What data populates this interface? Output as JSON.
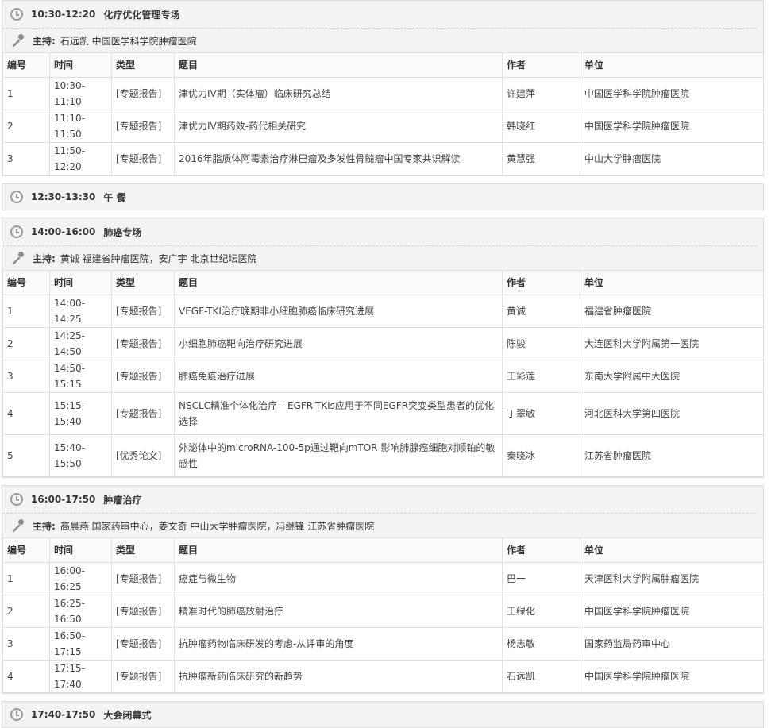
{
  "columns": [
    "编号",
    "时间",
    "类型",
    "题目",
    "作者",
    "单位"
  ],
  "sessions": [
    {
      "time": "10:30-12:20",
      "title": "化疗优化管理专场",
      "host_label": "主持:",
      "host": "石远凯 中国医学科学院肿瘤医院",
      "rows": [
        [
          "1",
          "10:30-11:10",
          "[专题报告]",
          "津优力IV期（实体瘤）临床研究总结",
          "许建萍",
          "中国医学科学院肿瘤医院"
        ],
        [
          "2",
          "11:10-11:50",
          "[专题报告]",
          "津优力IV期药效-药代相关研究",
          "韩晓红",
          "中国医学科学院肿瘤医院"
        ],
        [
          "3",
          "11:50-12:20",
          "[专题报告]",
          "2016年脂质体阿霉素治疗淋巴瘤及多发性骨髓瘤中国专家共识解读",
          "黄慧强",
          "中山大学肿瘤医院"
        ]
      ]
    },
    {
      "time": "12:30-13:30",
      "title": "午 餐"
    },
    {
      "time": "14:00-16:00",
      "title": "肺癌专场",
      "host_label": "主持:",
      "host": "黄诚 福建省肿瘤医院，安广宇 北京世纪坛医院",
      "rows": [
        [
          "1",
          "14:00-14:25",
          "[专题报告]",
          "VEGF-TKI治疗晚期非小细胞肺癌临床研究进展",
          "黄诚",
          "福建省肿瘤医院"
        ],
        [
          "2",
          "14:25-14:50",
          "[专题报告]",
          "小细胞肺癌靶向治疗研究进展",
          "陈骏",
          "大连医科大学附属第一医院"
        ],
        [
          "3",
          "14:50-15:15",
          "[专题报告]",
          "肺癌免疫治疗进展",
          "王彩莲",
          "东南大学附属中大医院"
        ],
        [
          "4",
          "15:15-15:40",
          "[专题报告]",
          "NSCLC精准个体化治疗---EGFR-TKIs应用于不同EGFR突变类型患者的优化选择",
          "丁翠敏",
          "河北医科大学第四医院"
        ],
        [
          "5",
          "15:40-15:50",
          "[优秀论文]",
          "外泌体中的microRNA-100-5p通过靶向mTOR 影响肺腺癌细胞对顺铂的敏感性",
          "秦晓冰",
          "江苏省肿瘤医院"
        ]
      ]
    },
    {
      "time": "16:00-17:50",
      "title": "肿瘤治疗",
      "host_label": "主持:",
      "host": "高晨燕 国家药审中心，姜文奇 中山大学肿瘤医院，冯继锋 江苏省肿瘤医院",
      "rows": [
        [
          "1",
          "16:00-16:25",
          "[专题报告]",
          "癌症与微生物",
          "巴一",
          "天津医科大学附属肿瘤医院"
        ],
        [
          "2",
          "16:25-16:50",
          "[专题报告]",
          "精准时代的肺癌放射治疗",
          "王绿化",
          "中国医学科学院肿瘤医院"
        ],
        [
          "3",
          "16:50-17:15",
          "[专题报告]",
          "抗肿瘤药物临床研发的考虑-从评审的角度",
          "杨志敏",
          "国家药监局药审中心"
        ],
        [
          "4",
          "17:15-17:40",
          "[专题报告]",
          "抗肿瘤新药临床研究的新趋势",
          "石远凯",
          "中国医学科学院肿瘤医院"
        ]
      ]
    },
    {
      "time": "17:40-17:50",
      "title": "大会闭幕式"
    }
  ]
}
